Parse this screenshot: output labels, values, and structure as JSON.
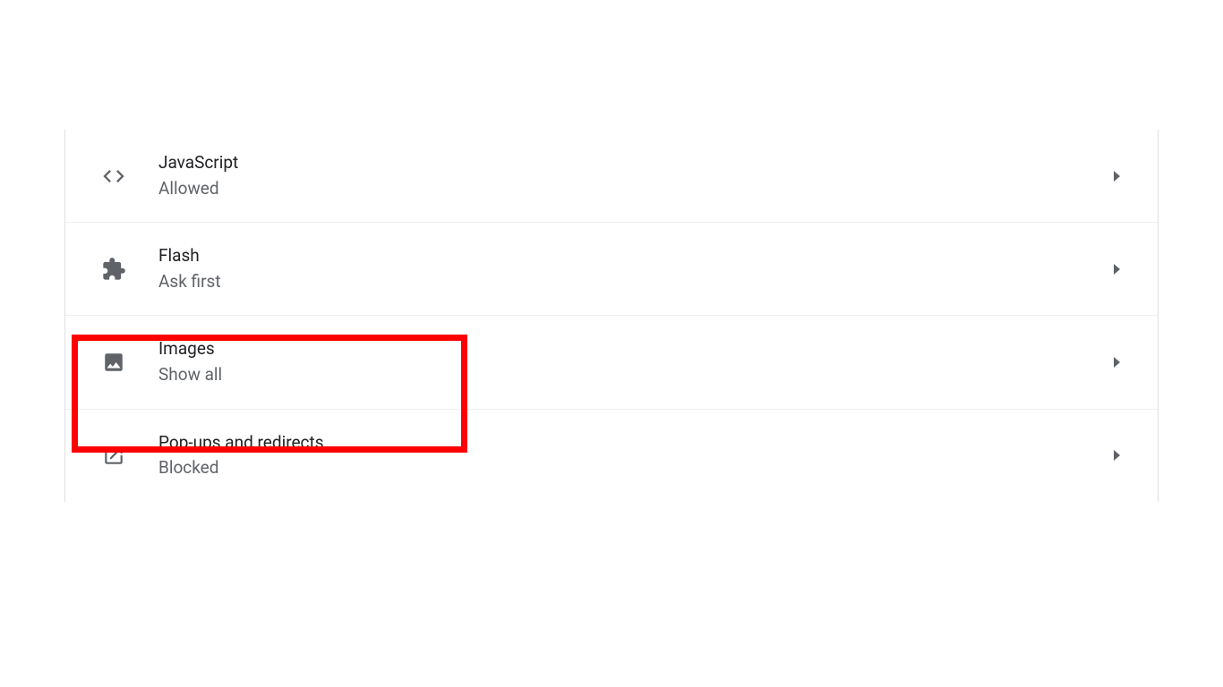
{
  "settings": [
    {
      "id": "javascript",
      "title": "JavaScript",
      "subtitle": "Allowed",
      "icon": "code-icon",
      "highlighted": false
    },
    {
      "id": "flash",
      "title": "Flash",
      "subtitle": "Ask first",
      "icon": "puzzle-icon",
      "highlighted": false
    },
    {
      "id": "images",
      "title": "Images",
      "subtitle": "Show all",
      "icon": "image-icon",
      "highlighted": true
    },
    {
      "id": "popups",
      "title": "Pop-ups and redirects",
      "subtitle": "Blocked",
      "icon": "popup-icon",
      "highlighted": false
    }
  ]
}
